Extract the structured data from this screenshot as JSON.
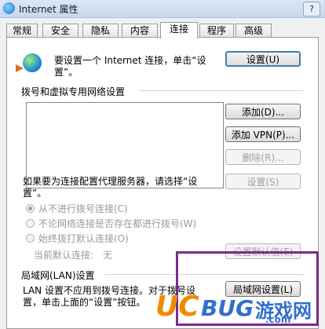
{
  "window": {
    "title": "Internet 属性",
    "help": "?"
  },
  "tabs": [
    "常规",
    "安全",
    "隐私",
    "内容",
    "连接",
    "程序",
    "高级"
  ],
  "active_tab": "连接",
  "setup": {
    "text_line1": "要设置一个 Internet 连接，单击“设",
    "text_line2": "置”。",
    "button": "设置(U)"
  },
  "dialup": {
    "group_title": "拨号和虚拟专用网络设置",
    "add_button": "添加(D)...",
    "add_vpn_button": "添加 VPN(P)...",
    "remove_button": "删除(R)...",
    "proxy_text_line1": "如果要为连接配置代理服务器，请选择“设",
    "proxy_text_line2": "置”。",
    "settings_button": "设置(S)",
    "options": [
      "从不进行拨号连接(C)",
      "不论网络连接是否存在都进行拨号(W)",
      "始终拨打默认连接(O)"
    ],
    "current_default_label": "当前默认连接:",
    "current_default_value": "无",
    "set_default_button": "设置默认值(E)"
  },
  "lan": {
    "group_title": "局域网(LAN)设置",
    "text_line1": "LAN 设置不应用到拨号连接。对于拨号设",
    "text_line2": "置，单击上面的“设置”按钮。",
    "button": "局域网设置(L)"
  },
  "watermark": {
    "logo_uc": "UC",
    "logo_bug": "BUG",
    "site": "游戏网",
    "domain": ".com"
  },
  "colors": {
    "overlay_border": "#7b2a8e",
    "watermark_orange": "#f08a00",
    "watermark_blue": "#2f6fd0"
  }
}
